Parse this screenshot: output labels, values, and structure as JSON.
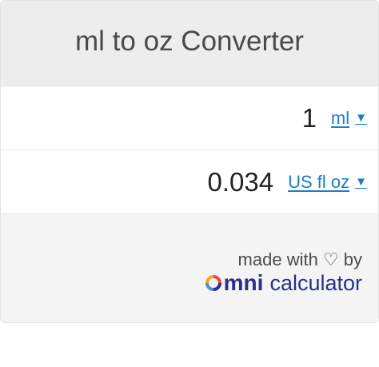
{
  "header": {
    "title": "ml to oz Converter"
  },
  "rows": [
    {
      "value": "1",
      "unit": "ml",
      "caret": "▼"
    },
    {
      "value": "0.034",
      "unit": "US fl oz",
      "caret": "▼"
    }
  ],
  "footer": {
    "made_with": "made with ♡ by",
    "brand_omni_rest": "mni",
    "brand_calculator": "calculator"
  },
  "colors": {
    "link": "#1a7fc9",
    "brand": "#2a2e8e",
    "omni_ring": [
      "#e84a4a",
      "#f5a623",
      "#4a90e2",
      "#2a2e8e"
    ]
  }
}
